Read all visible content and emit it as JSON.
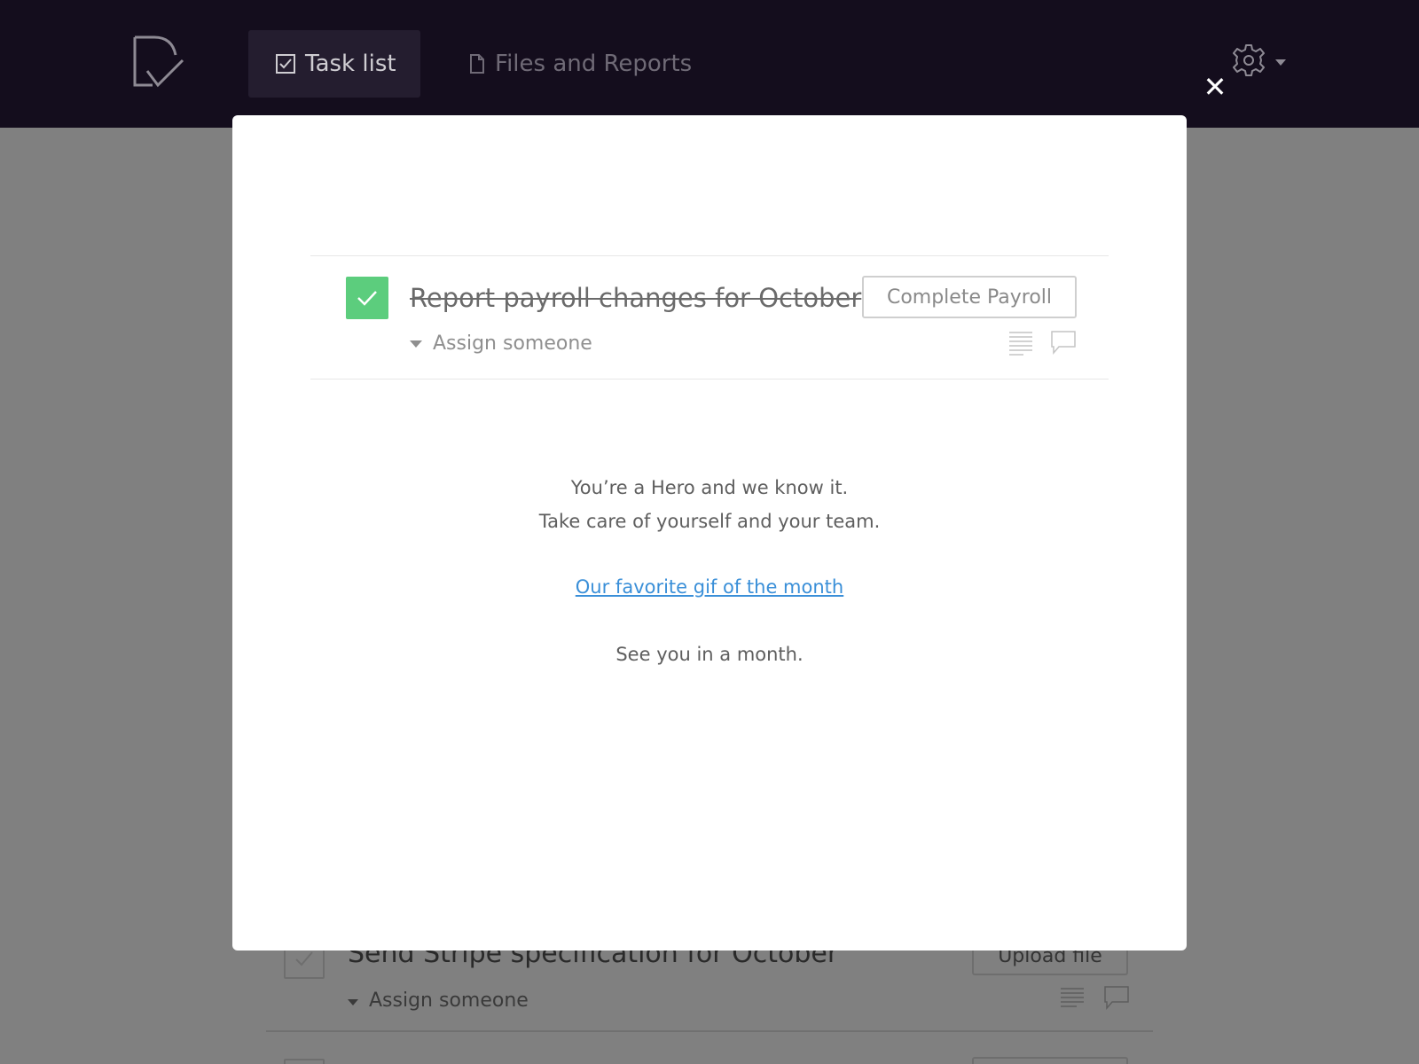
{
  "nav": {
    "tabs": [
      {
        "label": "Task list",
        "icon": "checkbox-icon",
        "active": true
      },
      {
        "label": "Files and Reports",
        "icon": "document-icon",
        "active": false
      }
    ],
    "settings_icon": "gear-icon"
  },
  "modal": {
    "task": {
      "title": "Report payroll changes for October",
      "completed": true,
      "action_label": "Complete Payroll",
      "assign_label": "Assign someone"
    },
    "message_line1": "You’re a Hero and we know it.",
    "message_line2": "Take care of yourself and your team.",
    "link_text": "Our favorite gif of the month",
    "message_line3": "See you in a month."
  },
  "background_task": {
    "title": "Send Stripe specification for October",
    "action_label": "Upload file",
    "assign_label": "Assign someone"
  },
  "colors": {
    "topbar": "#140d1d",
    "check_green": "#5ccd7d",
    "link_blue": "#3a8fd8",
    "overlay": "#808080"
  }
}
